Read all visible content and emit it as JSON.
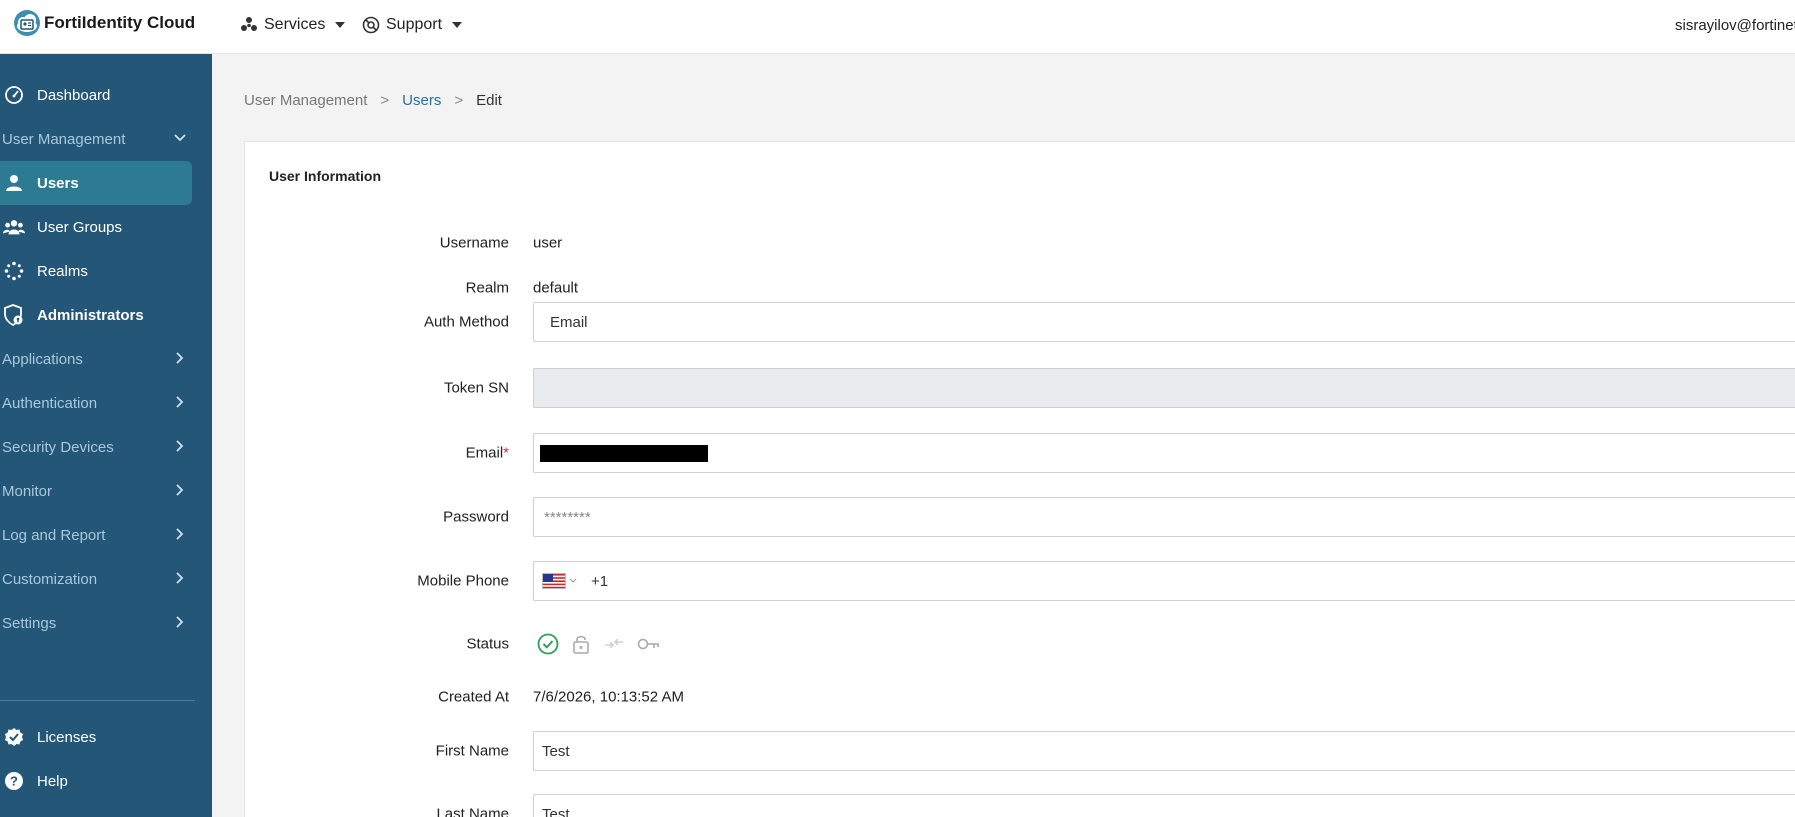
{
  "topbar": {
    "brand": "FortiIdentity Cloud",
    "services": "Services",
    "support": "Support",
    "user_email": "sisrayilov@fortinet"
  },
  "sidebar": {
    "dashboard": "Dashboard",
    "user_management": "User Management",
    "users": "Users",
    "user_groups": "User Groups",
    "realms": "Realms",
    "administrators": "Administrators",
    "applications": "Applications",
    "authentication": "Authentication",
    "security_devices": "Security Devices",
    "monitor": "Monitor",
    "log_and_report": "Log and Report",
    "customization": "Customization",
    "settings": "Settings",
    "licenses": "Licenses",
    "help": "Help"
  },
  "breadcrumb": {
    "root": "User Management",
    "users": "Users",
    "current": "Edit",
    "sep": ">"
  },
  "form": {
    "title": "User Information",
    "username_label": "Username",
    "username_value": "user",
    "realm_label": "Realm",
    "realm_value": "default",
    "auth_method_label": "Auth Method",
    "auth_method_value": "Email",
    "token_sn_label": "Token SN",
    "email_label": "Email",
    "email_required": "*",
    "password_label": "Password",
    "password_value": "********",
    "mobile_phone_label": "Mobile Phone",
    "mobile_phone_code": "+1",
    "status_label": "Status",
    "created_at_label": "Created At",
    "created_at_value": "7/6/2026, 10:13:52 AM",
    "first_name_label": "First Name",
    "first_name_value": "Test",
    "last_name_label": "Last Name",
    "last_name_value": "Test"
  },
  "colors": {
    "sidebar_bg": "#235677",
    "sidebar_active": "#2d7a93",
    "status_active": "#2e9e5b"
  }
}
